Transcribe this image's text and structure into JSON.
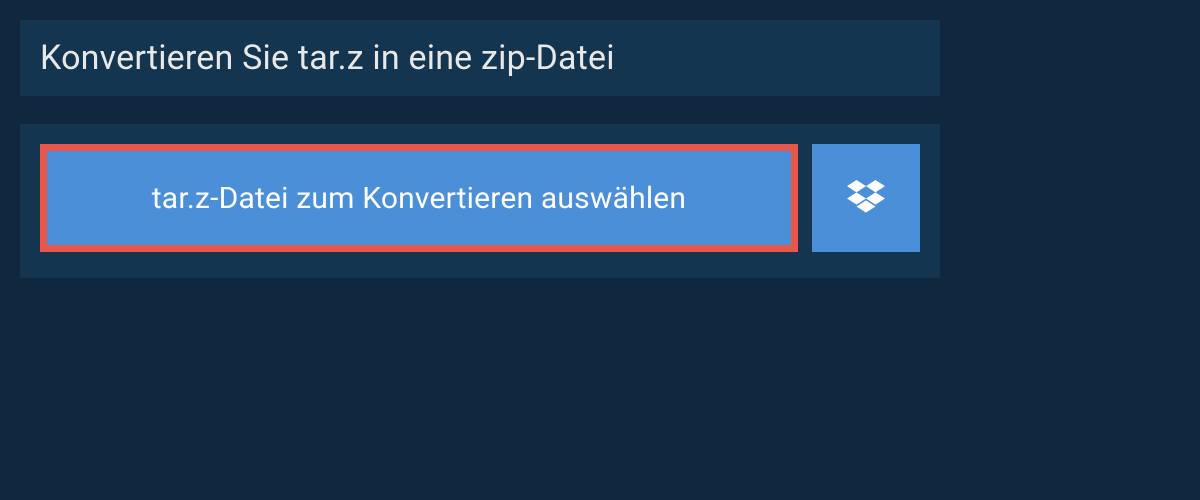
{
  "heading": "Konvertieren Sie tar.z in eine zip-Datei",
  "upload": {
    "select_label": "tar.z-Datei zum Konvertieren auswählen",
    "dropbox_icon": "dropbox-icon"
  },
  "colors": {
    "background_dark": "#0f2840",
    "panel": "#14354f",
    "button_blue": "#4a8fd8",
    "button_border": "#e8574c",
    "text_light": "#e8e8e8"
  }
}
